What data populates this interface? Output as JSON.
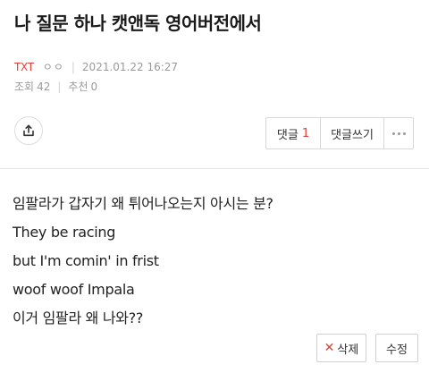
{
  "post": {
    "title": "나 질문 하나 캣앤독 영어버전에서",
    "category": "TXT",
    "author": "ㅇㅇ",
    "datetime": "2021.01.22 16:27",
    "views_label": "조회",
    "views": "42",
    "recommend_label": "추천",
    "recommend": "0"
  },
  "toolbar": {
    "share_icon": "share-icon",
    "comments_label": "댓글",
    "comments_count": "1",
    "write_comment_label": "댓글쓰기",
    "more_icon": "more-dots-icon"
  },
  "body": {
    "lines": [
      "임팔라가 갑자기 왜 튀어나오는지 아시는 분?",
      "They be racing",
      "but I'm comin' in frist",
      "woof woof Impala",
      "이거 임팔라 왜 나와??"
    ]
  },
  "actions": {
    "delete_label": "삭제",
    "edit_label": "수정"
  },
  "colors": {
    "accent": "#e0413a",
    "meta_gray": "#9a9a9a",
    "border": "#d8d8d8"
  }
}
